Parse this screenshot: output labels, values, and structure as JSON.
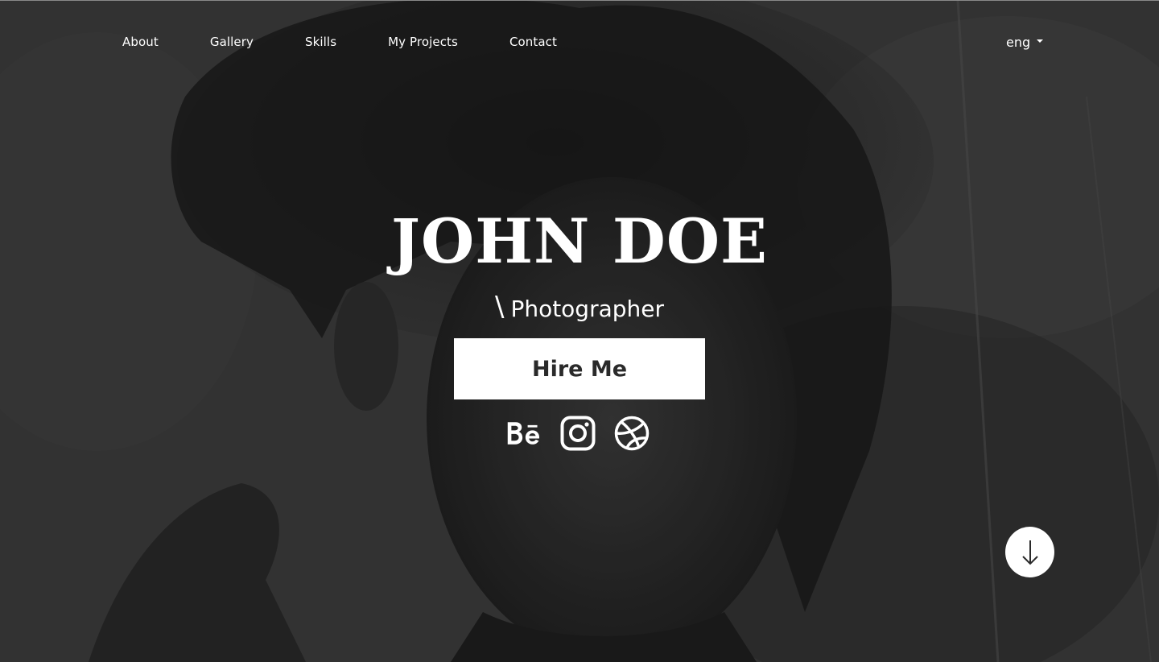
{
  "nav": {
    "items": [
      {
        "label": "About"
      },
      {
        "label": "Gallery"
      },
      {
        "label": "Skills"
      },
      {
        "label": "My Projects"
      },
      {
        "label": "Contact"
      }
    ]
  },
  "language": {
    "selected": "eng"
  },
  "hero": {
    "name": "JOHN DOE",
    "slash": "\\",
    "role": "Photographer",
    "cta_label": "Hire Me"
  },
  "socials": [
    {
      "icon": "behance-icon"
    },
    {
      "icon": "instagram-icon"
    },
    {
      "icon": "dribbble-icon"
    }
  ],
  "scroll": {
    "icon": "arrow-down-icon"
  },
  "colors": {
    "overlay": "#3a3a3a",
    "text": "#ffffff",
    "button_bg": "#ffffff",
    "button_text": "#2a2a2a"
  }
}
